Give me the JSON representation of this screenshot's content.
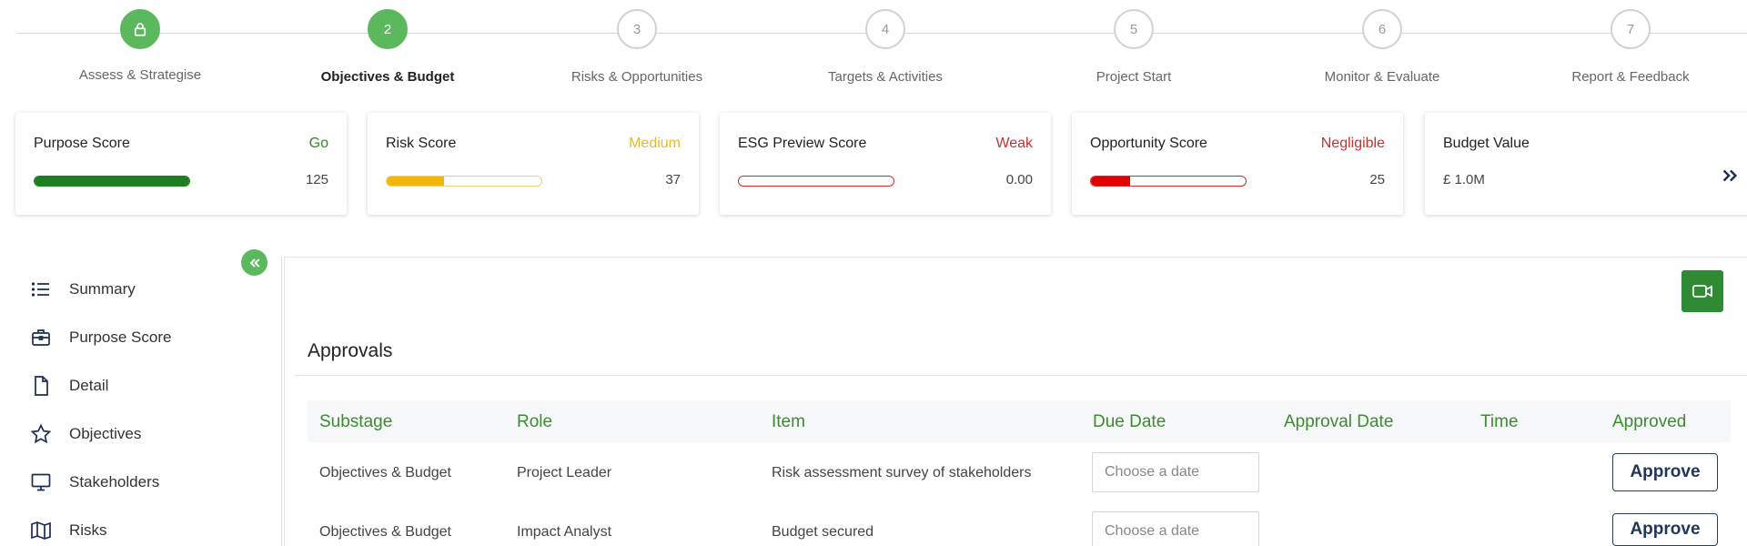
{
  "stepper": {
    "steps": [
      {
        "number": "",
        "label": "Assess & Strategise",
        "state": "done"
      },
      {
        "number": "2",
        "label": "Objectives & Budget",
        "state": "active"
      },
      {
        "number": "3",
        "label": "Risks & Opportunities",
        "state": "pending"
      },
      {
        "number": "4",
        "label": "Targets & Activities",
        "state": "pending"
      },
      {
        "number": "5",
        "label": "Project Start",
        "state": "pending"
      },
      {
        "number": "6",
        "label": "Monitor & Evaluate",
        "state": "pending"
      },
      {
        "number": "7",
        "label": "Report & Feedback",
        "state": "pending"
      }
    ]
  },
  "cards": {
    "purpose": {
      "title": "Purpose Score",
      "status": "Go",
      "status_color": "#2e8b1f",
      "value": "125",
      "bar_fill": 1.0,
      "bar_color": "#1e7d1e",
      "bar_border": "#1e7d1e"
    },
    "risk": {
      "title": "Risk Score",
      "status": "Medium",
      "status_color": "#e8b92a",
      "value": "37",
      "bar_fill": 0.37,
      "bar_color": "#f2b705",
      "bar_border": "#e7d27a"
    },
    "esg": {
      "title": "ESG Preview Score",
      "status": "Weak",
      "status_color": "#c9302c",
      "value": "0.00",
      "bar_fill": 0.0,
      "bar_color": "#c9302c",
      "bar_border": "#c9302c"
    },
    "opportunity": {
      "title": "Opportunity Score",
      "status": "Negligible",
      "status_color": "#c9302c",
      "value": "25",
      "bar_fill": 0.25,
      "bar_color": "#e00000",
      "bar_border": "#c9302c"
    },
    "budget": {
      "title": "Budget Value",
      "value": "£ 1.0M",
      "expand_icon": "double-chevron-right-icon"
    }
  },
  "sidebar": {
    "collapse_icon": "double-chevron-left-icon",
    "items": [
      {
        "label": "Summary",
        "icon": "list-icon"
      },
      {
        "label": "Purpose Score",
        "icon": "briefcase-icon"
      },
      {
        "label": "Detail",
        "icon": "document-icon"
      },
      {
        "label": "Objectives",
        "icon": "star-icon"
      },
      {
        "label": "Stakeholders",
        "icon": "monitor-icon"
      },
      {
        "label": "Risks",
        "icon": "map-icon"
      }
    ]
  },
  "main": {
    "video_icon": "video-camera-icon",
    "section_title": "Approvals",
    "table": {
      "columns": [
        "Substage",
        "Role",
        "Item",
        "Due Date",
        "Approval Date",
        "Time",
        "Approved"
      ],
      "rows": [
        {
          "substage": "Objectives & Budget",
          "role": "Project Leader",
          "item": "Risk assessment survey of stakeholders",
          "due_date_placeholder": "Choose a date",
          "approval_date": "",
          "time": "",
          "action": "Approve"
        },
        {
          "substage": "Objectives & Budget",
          "role": "Impact Analyst",
          "item": "Budget secured",
          "due_date_placeholder": "Choose a date",
          "approval_date": "",
          "time": "",
          "action": "Approve"
        }
      ]
    }
  }
}
